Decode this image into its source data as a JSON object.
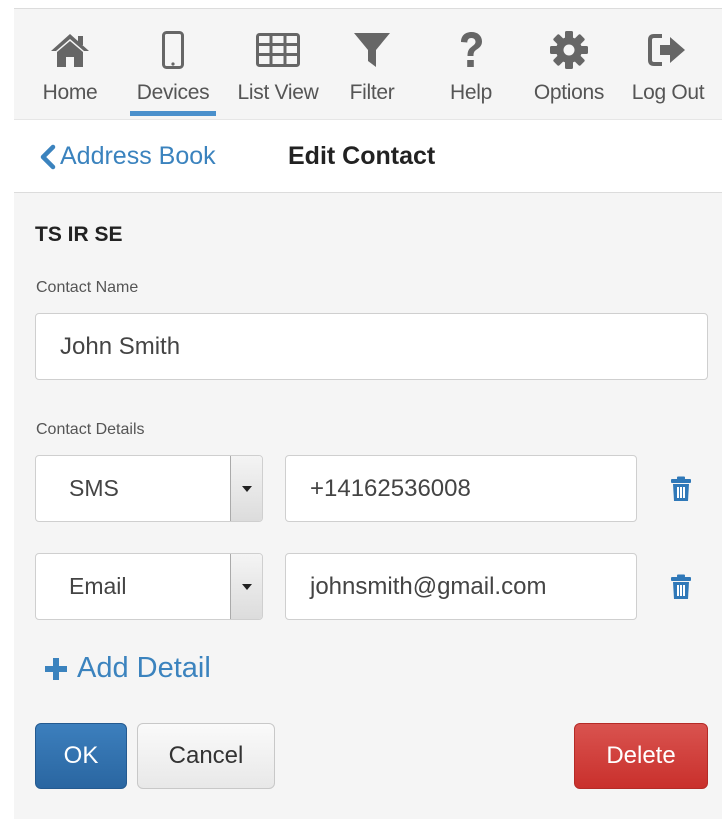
{
  "nav": {
    "items": [
      {
        "label": "Home",
        "icon": "home-icon"
      },
      {
        "label": "Devices",
        "icon": "mobile-icon",
        "active": true
      },
      {
        "label": "List View",
        "icon": "grid-icon"
      },
      {
        "label": "Filter",
        "icon": "filter-icon"
      },
      {
        "label": "Help",
        "icon": "question-icon"
      },
      {
        "label": "Options",
        "icon": "gear-icon"
      },
      {
        "label": "Log Out",
        "icon": "logout-icon"
      }
    ],
    "accent": "#4a90cc"
  },
  "header": {
    "back_label": "Address Book",
    "title": "Edit Contact"
  },
  "form": {
    "section_title": "TS IR SE",
    "contact_name_label": "Contact Name",
    "contact_name_value": "John Smith",
    "contact_details_label": "Contact Details",
    "details": [
      {
        "type": "SMS",
        "value": "+14162536008"
      },
      {
        "type": "Email",
        "value": "johnsmith@gmail.com"
      }
    ],
    "add_detail_label": "Add Detail"
  },
  "actions": {
    "ok_label": "OK",
    "cancel_label": "Cancel",
    "delete_label": "Delete"
  },
  "colors": {
    "link": "#3b83be",
    "primary": "#2e6da4",
    "danger": "#d9534f"
  }
}
